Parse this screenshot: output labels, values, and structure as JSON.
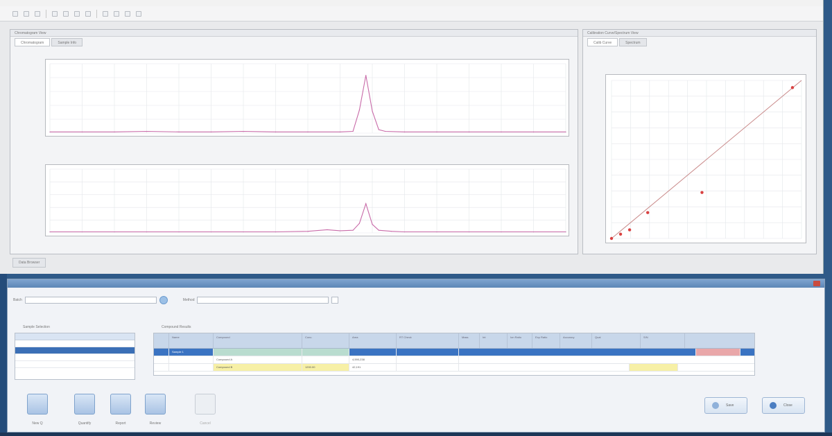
{
  "top_window": {
    "menu_items": [
      "",
      "",
      "",
      "",
      "",
      "",
      "",
      "",
      "",
      ""
    ],
    "chrom_panel_title": "Chromatogram View",
    "chrom_tabs": [
      "Chromatogram",
      "Sample Info"
    ],
    "calib_panel_title": "Calibration Curve/Spectrum View",
    "calib_tabs": [
      "Calib Curve",
      "Spectrum"
    ],
    "bottom_tab": "Data Browser"
  },
  "bottom_window": {
    "filter_label_1": "Batch",
    "filter_label_2": "Method",
    "list_title": "Sample Selection",
    "grid_title": "Compound Results",
    "grid_headers": [
      "Name",
      "Compound",
      "Conc.",
      "Area",
      "RT Check",
      "Mass",
      "Int",
      "Ion Ratio",
      "Exp Ratio",
      "Accuracy",
      "Qual",
      "S/N"
    ],
    "grid_rows": [
      {
        "name": "Sample 1",
        "compound": "",
        "conc": "",
        "area": "",
        "rt": "",
        "selected": true
      },
      {
        "name": "",
        "compound": "Compound A",
        "conc": "",
        "area": "4,590,238",
        "rt": "",
        "selected": false
      },
      {
        "name": "",
        "compound": "Compound B",
        "conc": "1200.00",
        "area": "42,191",
        "rt": "",
        "selected": false
      }
    ],
    "buttons": {
      "new_label": "New Q",
      "quantify_label": "Quantify",
      "report_label": "Report",
      "review_label": "Review",
      "disabled_label": "Cancel",
      "save_label": "Save",
      "close_label": "Close"
    }
  },
  "chart_data": [
    {
      "type": "line",
      "title": "",
      "x": [
        0,
        0.5,
        1.0,
        1.5,
        2.0,
        2.5,
        3.0,
        3.5,
        4.0,
        4.5,
        4.7,
        4.8,
        4.9,
        5.0,
        5.1,
        5.2,
        5.5,
        6.0,
        6.5,
        7.0,
        7.5,
        8.0
      ],
      "series": [
        {
          "values": [
            2,
            2,
            2,
            3,
            2,
            2,
            3,
            2,
            2,
            2,
            3,
            40,
            100,
            38,
            6,
            3,
            2,
            2,
            2,
            2,
            2,
            2
          ]
        }
      ],
      "ylim": [
        0,
        120
      ]
    },
    {
      "type": "line",
      "title": "",
      "x": [
        0,
        0.5,
        1.0,
        1.5,
        2.0,
        2.5,
        3.0,
        3.5,
        4.0,
        4.3,
        4.5,
        4.7,
        4.8,
        4.9,
        5.0,
        5.1,
        5.3,
        5.5,
        6.0,
        6.5,
        7.0,
        7.5,
        8.0
      ],
      "series": [
        {
          "values": [
            2,
            2,
            2,
            2,
            2,
            2,
            2,
            2,
            3,
            6,
            4,
            5,
            18,
            55,
            16,
            5,
            3,
            2,
            2,
            2,
            2,
            2,
            2
          ]
        }
      ],
      "ylim": [
        0,
        120
      ]
    },
    {
      "type": "scatter",
      "title": "",
      "x": [
        0,
        5,
        10,
        20,
        50,
        100
      ],
      "series": [
        {
          "values": [
            0,
            3,
            6,
            18,
            32,
            105
          ]
        }
      ],
      "fit_line": [
        [
          0,
          0
        ],
        [
          105,
          110
        ]
      ],
      "xlim": [
        0,
        105
      ],
      "ylim": [
        0,
        110
      ]
    }
  ]
}
